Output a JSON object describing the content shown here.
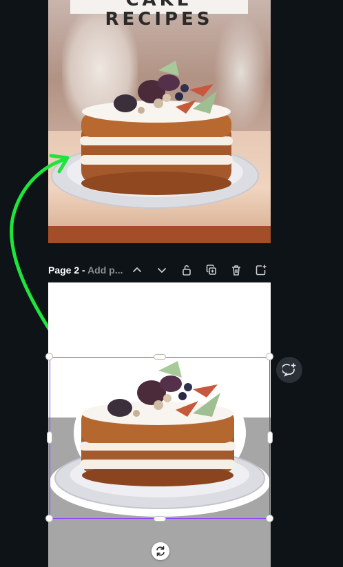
{
  "page1": {
    "title_text": "CAKE RECIPES"
  },
  "page2_header": {
    "page_label": "Page 2 - ",
    "title_placeholder": "Add p..."
  },
  "toolbar": {
    "icons": [
      "chevron-up-icon",
      "chevron-down-icon",
      "unlock-icon",
      "duplicate-icon",
      "trash-icon",
      "add-page-icon"
    ]
  },
  "side_actions": {
    "comment_icon": "add-comment-icon",
    "rotate_icon": "rotate-icon"
  },
  "colors": {
    "canvas_bg": "#0e1318",
    "selection": "#8b3dff",
    "arrow": "#1ee53c"
  }
}
